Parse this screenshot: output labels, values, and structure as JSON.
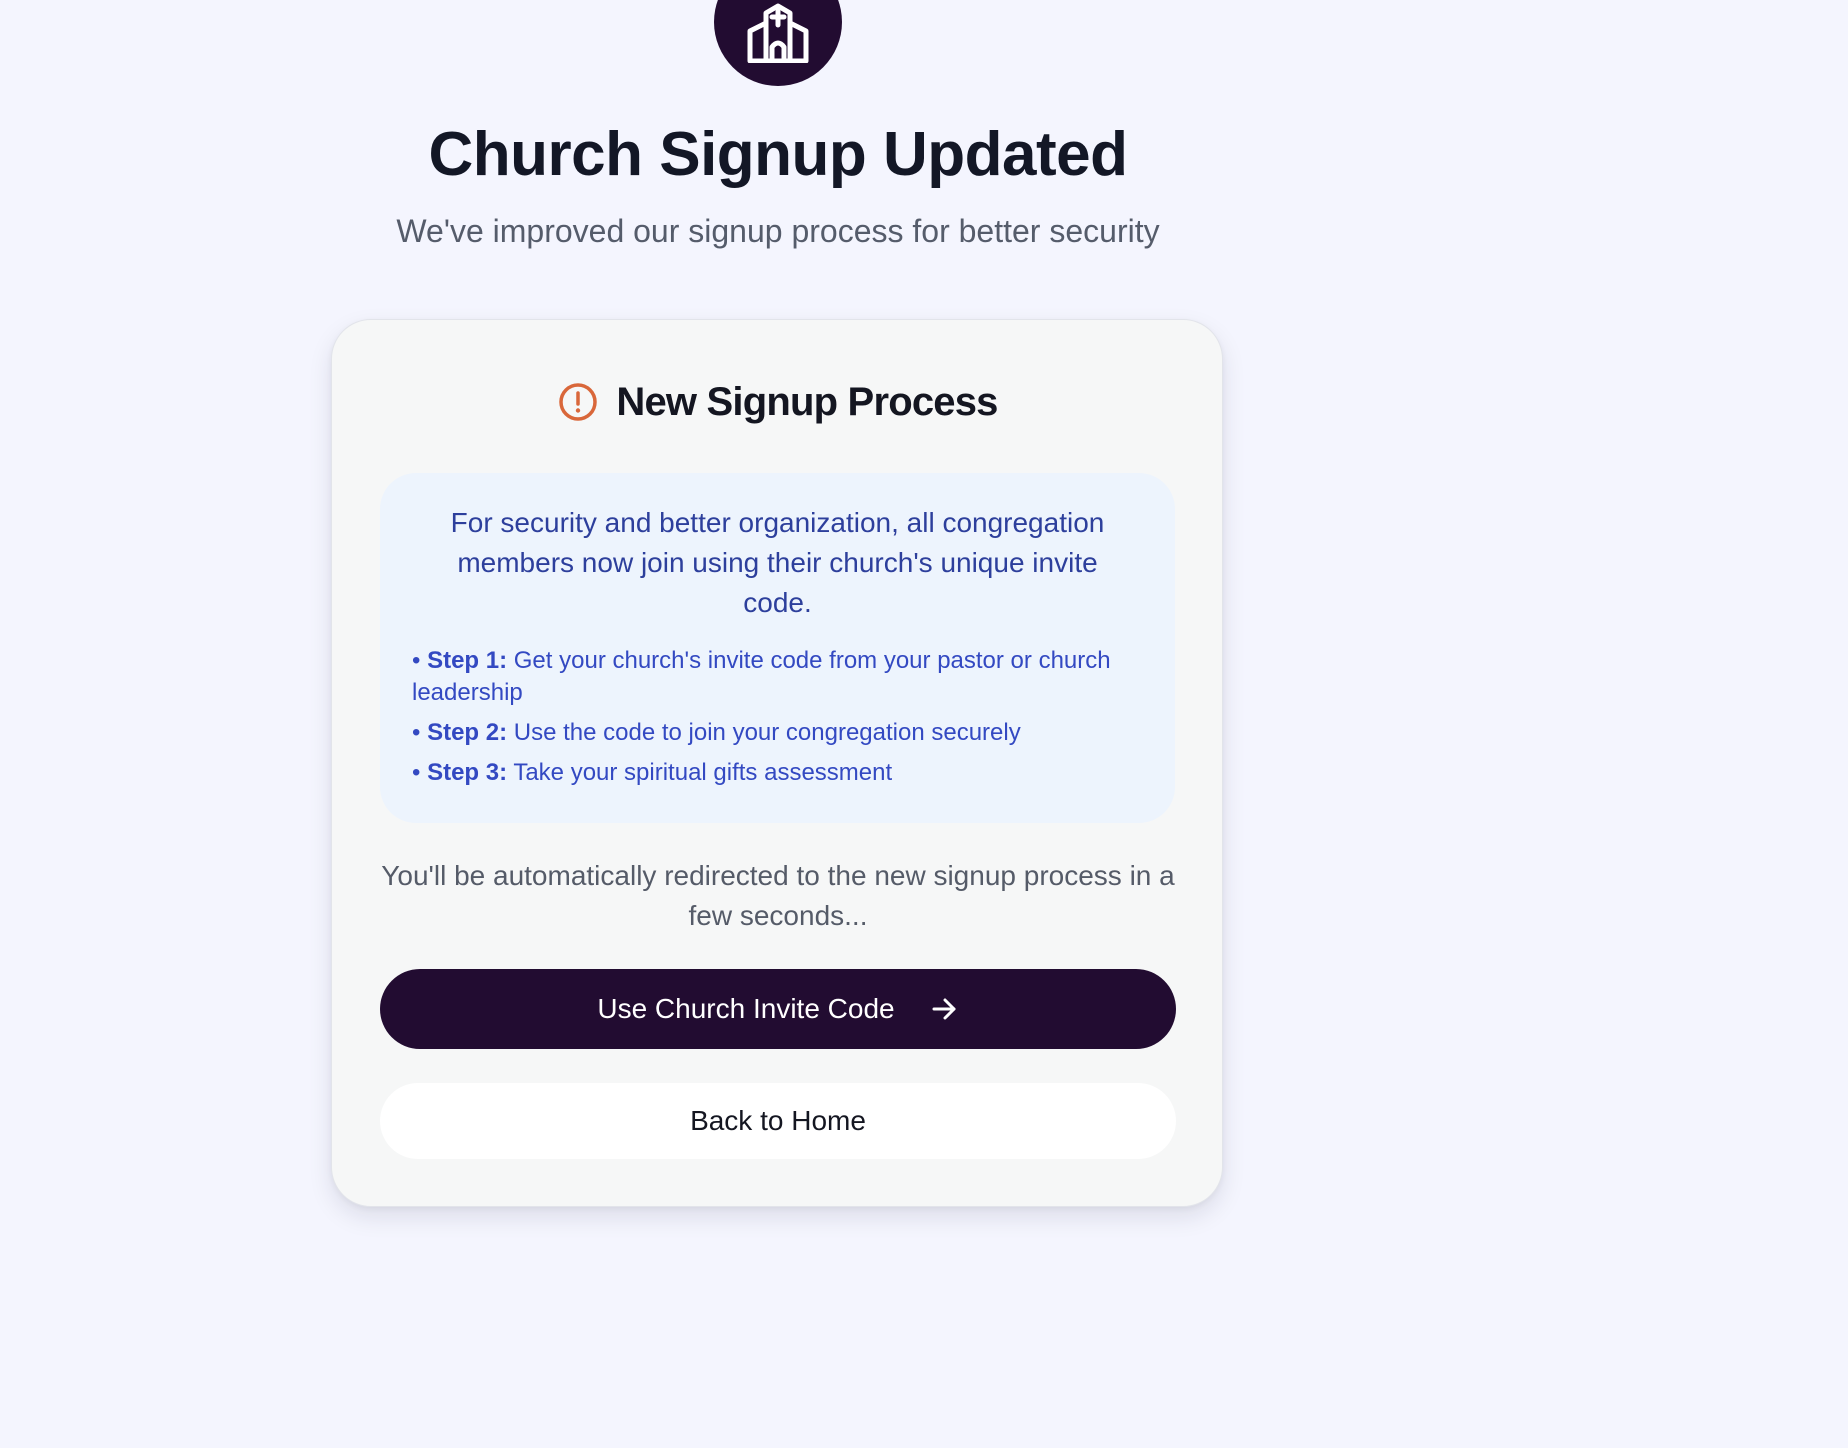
{
  "header": {
    "logo_icon": "church-icon",
    "title": "Church Signup Updated",
    "subtitle": "We've improved our signup process for better security"
  },
  "card": {
    "alert_icon": "alert-circle-icon",
    "title": "New Signup Process",
    "info_text": "For security and better organization, all congregation members now join using their church's unique invite code.",
    "steps": [
      {
        "label": "Step 1:",
        "text": "Get your church's invite code from your pastor or church leadership"
      },
      {
        "label": "Step 2:",
        "text": "Use the code to join your congregation securely"
      },
      {
        "label": "Step 3:",
        "text": "Take your spiritual gifts assessment"
      }
    ],
    "redirect_text": "You'll be automatically redirected to the new signup process in a few seconds...",
    "primary_button": {
      "label": "Use Church Invite Code",
      "icon": "arrow-right-icon"
    },
    "secondary_button": {
      "label": "Back to Home"
    }
  },
  "colors": {
    "background": "#f4f5fe",
    "brand": "#220c31",
    "alert": "#d9673a",
    "info_text": "#2d3f9c",
    "step_text": "#3349c2"
  }
}
